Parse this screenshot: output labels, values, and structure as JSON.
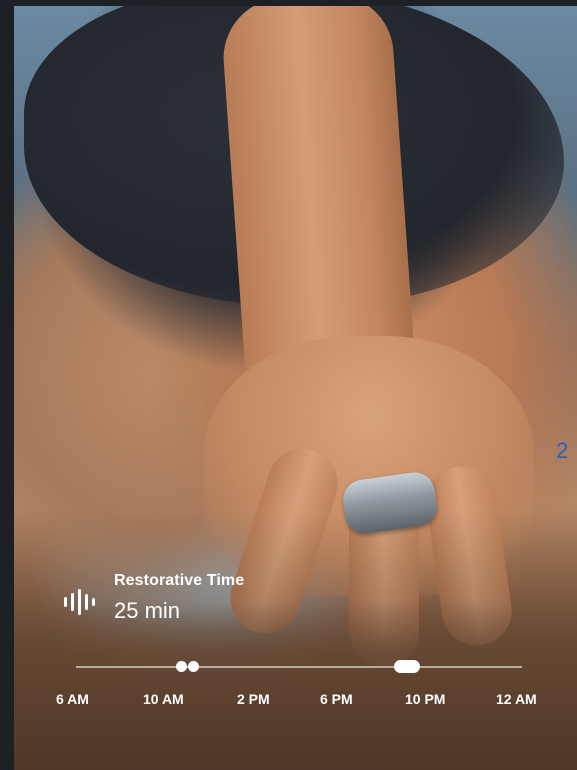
{
  "metric": {
    "icon": "waveform-icon",
    "label": "Restorative Time",
    "value": "25 min"
  },
  "timeline": {
    "ticks": [
      "6 AM",
      "10 AM",
      "2 PM",
      "6 PM",
      "10 PM",
      "12 AM"
    ],
    "markers": [
      {
        "type": "dot",
        "time_label": "~11 AM"
      },
      {
        "type": "dot",
        "time_label": "~11 AM"
      },
      {
        "type": "pill",
        "time_label": "~10 PM"
      }
    ]
  },
  "page_indicator": "2",
  "colors": {
    "overlay_text": "#ffffff",
    "page_indicator": "#1f66c7"
  }
}
